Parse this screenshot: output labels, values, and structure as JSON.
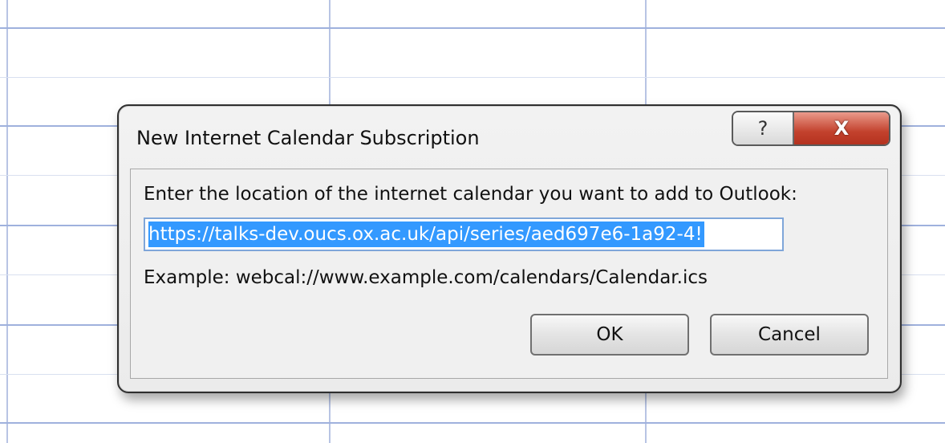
{
  "dialog": {
    "title": "New Internet Calendar Subscription",
    "help_label": "?",
    "close_label": "X",
    "prompt": "Enter the location of the internet calendar you want to add to Outlook:",
    "url_value": "https://talks-dev.oucs.ox.ac.uk/api/series/aed697e6-1a92-4!",
    "example": "Example: webcal://www.example.com/calendars/Calendar.ics",
    "ok_label": "OK",
    "cancel_label": "Cancel"
  },
  "colors": {
    "close_button": "#c3422d",
    "selection": "#3399ff",
    "grid_line": "#9fb1dd"
  }
}
